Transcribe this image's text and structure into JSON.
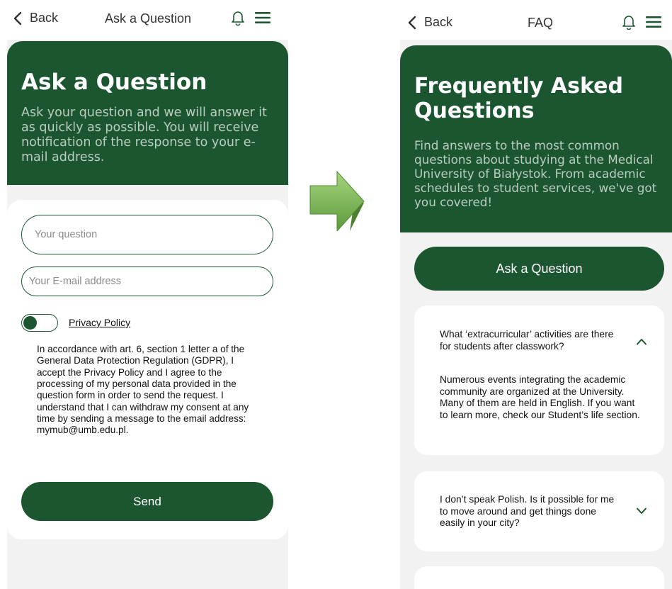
{
  "left_screen": {
    "topbar": {
      "back_label": "Back",
      "title": "Ask a Question"
    },
    "hero": {
      "heading": "Ask a Question",
      "description": "Ask your question and we will answer it as quickly as possible. You will receive notification of the response to your e-mail address."
    },
    "form": {
      "question_placeholder": "Your question",
      "email_placeholder": "Your E-mail address",
      "privacy_toggle_on": false,
      "privacy_label": "Privacy Policy",
      "consent_text": "In accordance with art. 6, section 1 letter a of the General Data Protection Regulation (GDPR), I accept the Privacy Policy and I agree to the processing of my personal data provided in the question form in order to send the request. I understand that I can withdraw my consent at any time by sending a message to the email address: mymub@umb.edu.pl.",
      "send_label": "Send"
    }
  },
  "right_screen": {
    "topbar": {
      "back_label": "Back",
      "title": "FAQ"
    },
    "hero": {
      "heading": "Frequently Asked Questions",
      "description": "Find answers to the most common questions about studying at the Medical University of Białystok. From academic schedules to student services, we've got you covered!"
    },
    "ask_button_label": "Ask a Question",
    "faq": [
      {
        "question": "What ‘extracurricular’ activities are there for students after classwork?",
        "answer": "Numerous events integrating the academic community are organized at the University. Many of them are held in English. If you want to learn more, check our Student’s life section.",
        "expanded": true,
        "chevron_icon": "chevron-up-icon"
      },
      {
        "question": "I don’t speak Polish. Is it possible for me to move around and get things done easily in your city?",
        "answer": "",
        "expanded": false,
        "chevron_icon": "chevron-down-icon"
      }
    ]
  },
  "icons": {
    "back": "chevron-left-icon",
    "bell": "bell-icon",
    "menu": "hamburger-menu-icon",
    "transition": "arrow-right-icon"
  },
  "colors": {
    "brand_green": "#1b5631",
    "hero_text_muted": "#b9cdbf",
    "page_background": "#f2f2f2",
    "arrow_green": "#6aa84f"
  }
}
